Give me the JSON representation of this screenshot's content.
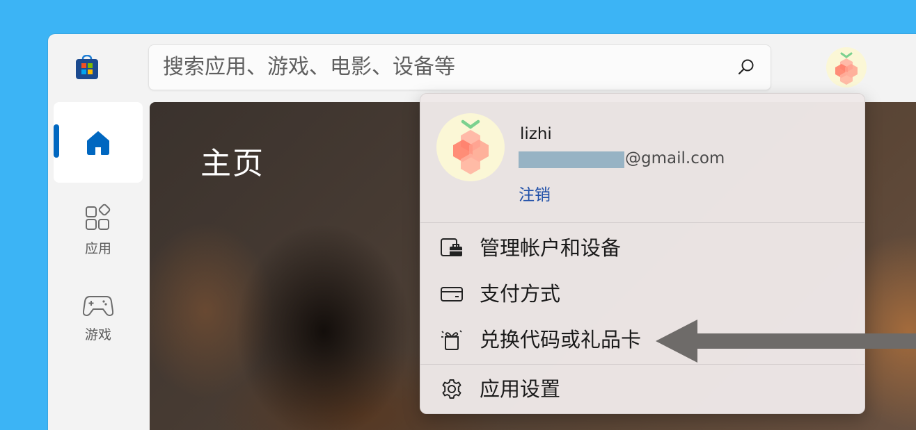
{
  "search": {
    "placeholder": "搜索应用、游戏、电影、设备等"
  },
  "nav": {
    "items": [
      {
        "label": ""
      },
      {
        "label": "应用"
      },
      {
        "label": "游戏"
      }
    ]
  },
  "hero": {
    "title": "主页"
  },
  "account_menu": {
    "user_name": "lizhi",
    "email_domain": "@gmail.com",
    "sign_out": "注销",
    "items": [
      {
        "label": "管理帐户和设备",
        "icon": "account-devices-icon"
      },
      {
        "label": "支付方式",
        "icon": "credit-card-icon"
      },
      {
        "label": "兑换代码或礼品卡",
        "icon": "redeem-gift-icon"
      },
      {
        "label": "应用设置",
        "icon": "gear-icon"
      }
    ]
  },
  "colors": {
    "accent": "#0067c0",
    "link": "#1f4fa8",
    "background": "#3cb4f5"
  }
}
